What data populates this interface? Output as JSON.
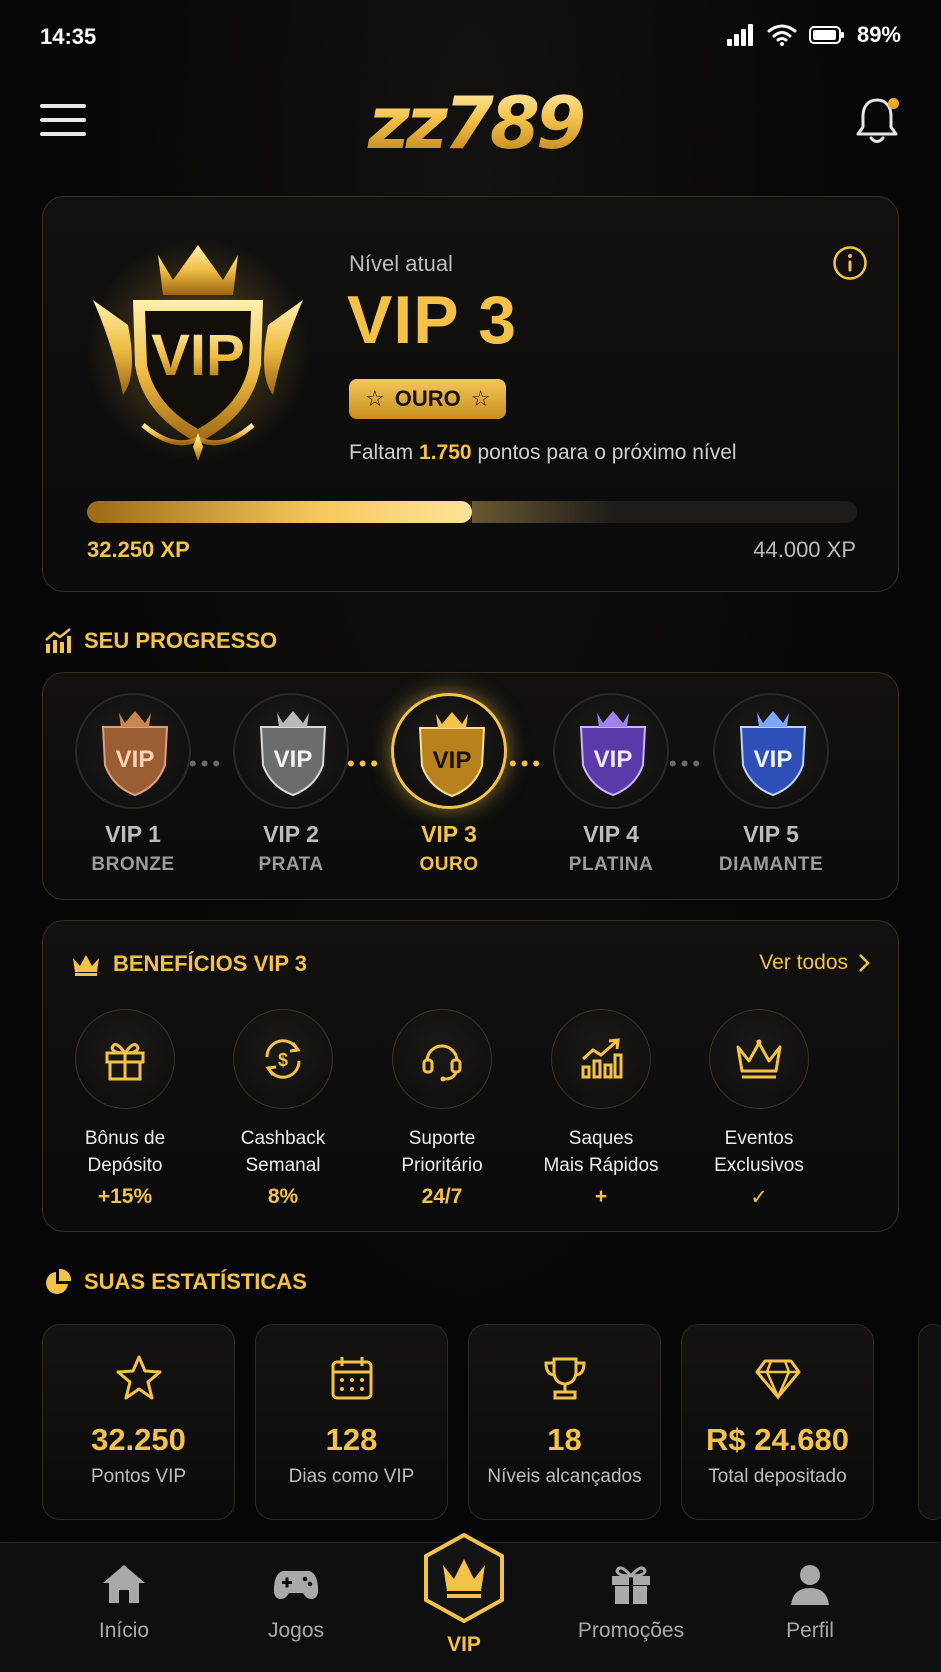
{
  "status": {
    "time": "14:35",
    "battery": "89%"
  },
  "brand": {
    "logo_text": "zz789"
  },
  "current_level": {
    "caption": "Nível atual",
    "name": "VIP 3",
    "emblem_text": "VIP",
    "tier": "OURO",
    "next_prefix": "Faltam",
    "points_needed": "1.750",
    "next_suffix": "pontos para o próximo nível",
    "xp_current": "32.250 XP",
    "xp_target": "44.000 XP",
    "progress_fraction": 0.5
  },
  "progress_section": {
    "title": "SEU PROGRESSO",
    "levels": [
      {
        "name": "VIP 1",
        "tier": "BRONZE",
        "badge": "VIP",
        "active": false
      },
      {
        "name": "VIP 2",
        "tier": "PRATA",
        "badge": "VIP",
        "active": false
      },
      {
        "name": "VIP 3",
        "tier": "OURO",
        "badge": "VIP",
        "active": true
      },
      {
        "name": "VIP 4",
        "tier": "PLATINA",
        "badge": "VIP",
        "active": false
      },
      {
        "name": "VIP 5",
        "tier": "DIAMANTE",
        "badge": "VIP",
        "active": false
      }
    ]
  },
  "benefits": {
    "title": "BENEFÍCIOS VIP 3",
    "see_all": "Ver todos",
    "items": [
      {
        "line1": "Bônus de",
        "line2": "Depósito",
        "value": "+15%",
        "icon": "gift-icon"
      },
      {
        "line1": "Cashback",
        "line2": "Semanal",
        "value": "8%",
        "icon": "cashback-icon"
      },
      {
        "line1": "Suporte",
        "line2": "Prioritário",
        "value": "24/7",
        "icon": "headset-icon"
      },
      {
        "line1": "Saques",
        "line2": "Mais Rápidos",
        "value": "+",
        "icon": "chart-up-icon"
      },
      {
        "line1": "Eventos",
        "line2": "Exclusivos",
        "value": "✓",
        "icon": "crown-icon"
      }
    ]
  },
  "stats": {
    "title": "SUAS ESTATÍSTICAS",
    "items": [
      {
        "value": "32.250",
        "label": "Pontos VIP",
        "icon": "star-icon"
      },
      {
        "value": "128",
        "label": "Dias como VIP",
        "icon": "calendar-icon"
      },
      {
        "value": "18",
        "label": "Níveis alcançados",
        "icon": "trophy-icon"
      },
      {
        "value": "R$ 24.680",
        "label": "Total depositado",
        "icon": "diamond-icon"
      }
    ]
  },
  "nav": {
    "items": [
      {
        "label": "Início",
        "icon": "home-icon"
      },
      {
        "label": "Jogos",
        "icon": "gamepad-icon"
      },
      {
        "label": "VIP",
        "icon": "crown-icon"
      },
      {
        "label": "Promoções",
        "icon": "gift-icon"
      },
      {
        "label": "Perfil",
        "icon": "user-icon"
      }
    ],
    "active": "VIP"
  },
  "colors": {
    "accent": "#f4c24a",
    "background": "#070707",
    "card_border": "#3a3020"
  }
}
